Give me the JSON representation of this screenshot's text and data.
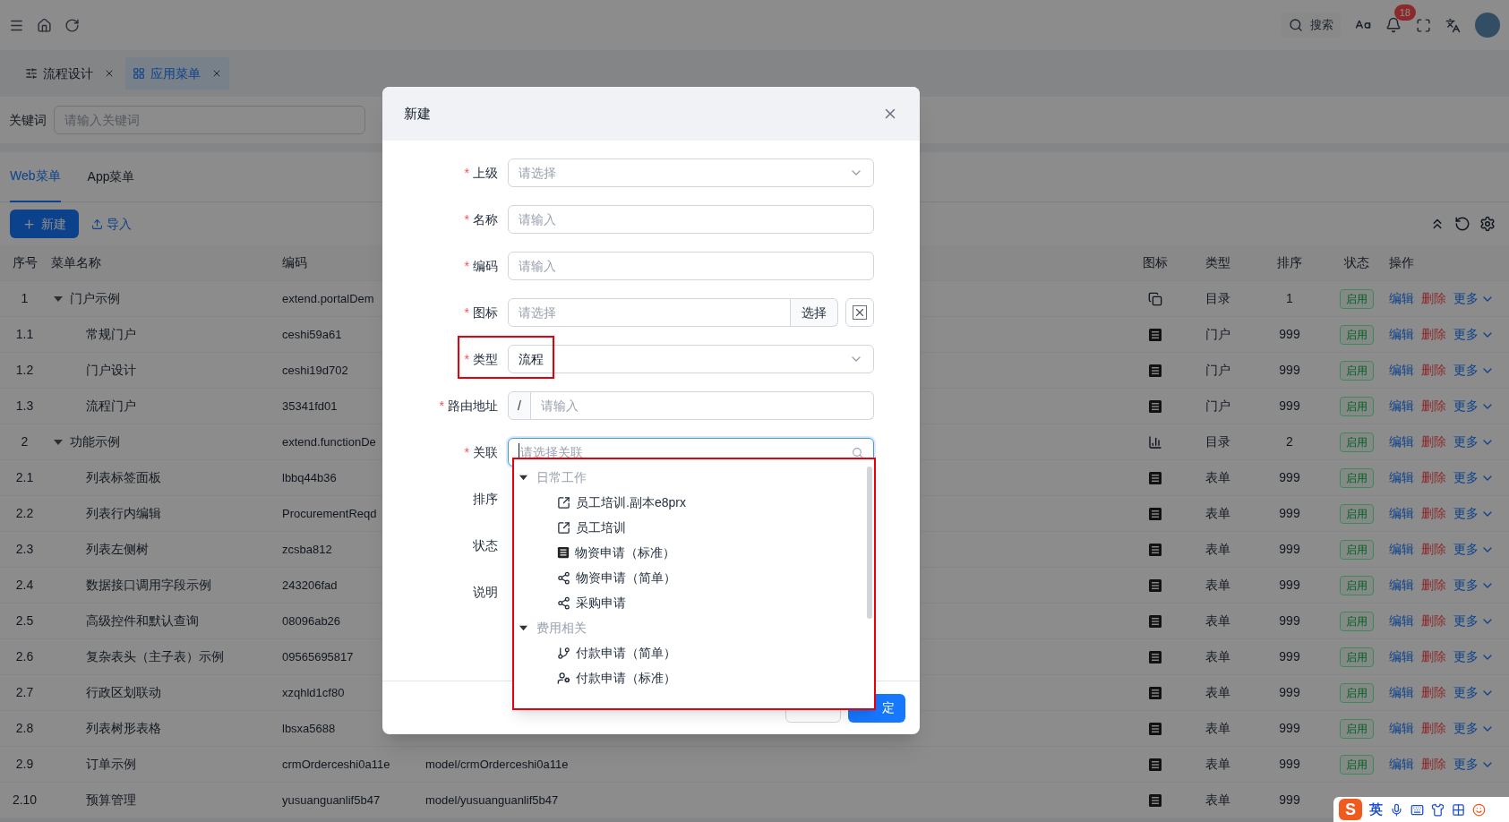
{
  "topbar": {
    "search_label": "搜索",
    "notification_count": "18"
  },
  "page_tabs": [
    {
      "label": "流程设计",
      "kind": "flow",
      "selected": false
    },
    {
      "label": "应用菜单",
      "kind": "grid",
      "selected": true
    }
  ],
  "filter": {
    "label": "关键词",
    "placeholder": "请输入关键词"
  },
  "menu_tabs": [
    {
      "label": "Web菜单",
      "selected": true
    },
    {
      "label": "App菜单",
      "selected": false
    }
  ],
  "toolbar": {
    "new_button": "新建",
    "import_button": "导入"
  },
  "table": {
    "columns": [
      "序号",
      "菜单名称",
      "编码",
      "图标",
      "类型",
      "排序",
      "状态",
      "操作"
    ],
    "rows": [
      {
        "no": "1",
        "name": "门户示例",
        "code": "extend.portalDem",
        "kind": "window",
        "type": "目录",
        "sort": "1",
        "status": "启用",
        "actions": [
          {
            "label": "编辑",
            "kind": "edit"
          },
          {
            "label": "删除",
            "kind": "delete"
          },
          {
            "label": "更多",
            "kind": "more"
          }
        ],
        "expanded": true,
        "children": [
          {
            "no": "1.1",
            "name": "常规门户",
            "code": "ceshi59a61",
            "kind": "list",
            "type": "门户",
            "sort": "999",
            "status": "启用",
            "actions": [
              {
                "label": "编辑",
                "kind": "edit"
              },
              {
                "label": "删除",
                "kind": "delete"
              },
              {
                "label": "更多",
                "kind": "more"
              }
            ]
          },
          {
            "no": "1.2",
            "name": "门户设计",
            "code": "ceshi19d702",
            "kind": "list",
            "type": "门户",
            "sort": "999",
            "status": "启用",
            "actions": [
              {
                "label": "编辑",
                "kind": "edit"
              },
              {
                "label": "删除",
                "kind": "delete"
              },
              {
                "label": "更多",
                "kind": "more"
              }
            ]
          },
          {
            "no": "1.3",
            "name": "流程门户",
            "code": "35341fd01",
            "kind": "list",
            "type": "门户",
            "sort": "999",
            "status": "启用",
            "actions": [
              {
                "label": "编辑",
                "kind": "edit"
              },
              {
                "label": "删除",
                "kind": "delete"
              },
              {
                "label": "更多",
                "kind": "more"
              }
            ]
          }
        ]
      },
      {
        "no": "2",
        "name": "功能示例",
        "code": "extend.functionDe",
        "kind": "chart",
        "type": "目录",
        "sort": "2",
        "status": "启用",
        "actions": [
          {
            "label": "编辑",
            "kind": "edit"
          },
          {
            "label": "删除",
            "kind": "delete"
          },
          {
            "label": "更多",
            "kind": "more"
          }
        ],
        "expanded": true,
        "children": [
          {
            "no": "2.1",
            "name": "列表标签面板",
            "code": "lbbq44b36",
            "kind": "list",
            "type": "表单",
            "sort": "999",
            "status": "启用",
            "actions": [
              {
                "label": "编辑",
                "kind": "edit"
              },
              {
                "label": "删除",
                "kind": "delete"
              },
              {
                "label": "更多",
                "kind": "more"
              }
            ]
          },
          {
            "no": "2.2",
            "name": "列表行内编辑",
            "code": "ProcurementReqd",
            "kind": "list",
            "type": "表单",
            "sort": "999",
            "status": "启用",
            "actions": [
              {
                "label": "编辑",
                "kind": "edit"
              },
              {
                "label": "删除",
                "kind": "delete"
              },
              {
                "label": "更多",
                "kind": "more"
              }
            ]
          },
          {
            "no": "2.3",
            "name": "列表左侧树",
            "code": "zcsba812",
            "kind": "list",
            "type": "表单",
            "sort": "999",
            "status": "启用",
            "actions": [
              {
                "label": "编辑",
                "kind": "edit"
              },
              {
                "label": "删除",
                "kind": "delete"
              },
              {
                "label": "更多",
                "kind": "more"
              }
            ]
          },
          {
            "no": "2.4",
            "name": "数据接口调用字段示例",
            "code": "243206fad",
            "kind": "list",
            "type": "表单",
            "sort": "999",
            "status": "启用",
            "actions": [
              {
                "label": "编辑",
                "kind": "edit"
              },
              {
                "label": "删除",
                "kind": "delete"
              },
              {
                "label": "更多",
                "kind": "more"
              }
            ]
          },
          {
            "no": "2.5",
            "name": "高级控件和默认查询",
            "code": "08096ab26",
            "kind": "list",
            "type": "表单",
            "sort": "999",
            "status": "启用",
            "actions": [
              {
                "label": "编辑",
                "kind": "edit"
              },
              {
                "label": "删除",
                "kind": "delete"
              },
              {
                "label": "更多",
                "kind": "more"
              }
            ]
          },
          {
            "no": "2.6",
            "name": "复杂表头（主子表）示例",
            "code": "09565695817",
            "kind": "list",
            "type": "表单",
            "sort": "999",
            "status": "启用",
            "actions": [
              {
                "label": "编辑",
                "kind": "edit"
              },
              {
                "label": "删除",
                "kind": "delete"
              },
              {
                "label": "更多",
                "kind": "more"
              }
            ]
          },
          {
            "no": "2.7",
            "name": "行政区划联动",
            "code": "xzqhld1cf80",
            "kind": "list",
            "type": "表单",
            "sort": "999",
            "status": "启用",
            "actions": [
              {
                "label": "编辑",
                "kind": "edit"
              },
              {
                "label": "删除",
                "kind": "delete"
              },
              {
                "label": "更多",
                "kind": "more"
              }
            ]
          },
          {
            "no": "2.8",
            "name": "列表树形表格",
            "code": "lbsxa5688",
            "kind": "list",
            "type": "表单",
            "sort": "999",
            "status": "启用",
            "actions": [
              {
                "label": "编辑",
                "kind": "edit"
              },
              {
                "label": "删除",
                "kind": "delete"
              },
              {
                "label": "更多",
                "kind": "more"
              }
            ]
          },
          {
            "no": "2.9",
            "name": "订单示例",
            "code": "crmOrderceshi0a11e",
            "path": "model/crmOrderceshi0a11e",
            "kind": "list",
            "type": "表单",
            "sort": "999",
            "status": "启用",
            "actions": [
              {
                "label": "编辑",
                "kind": "edit"
              },
              {
                "label": "删除",
                "kind": "delete"
              },
              {
                "label": "更多",
                "kind": "more"
              }
            ]
          },
          {
            "no": "2.10",
            "name": "预算管理",
            "code": "yusuanguanlif5b47",
            "path": "model/yusuanguanlif5b47",
            "kind": "list",
            "type": "表单",
            "sort": "999"
          }
        ]
      }
    ]
  },
  "dialog": {
    "title": "新建",
    "fields": [
      {
        "label": "上级",
        "required_mark": "*",
        "kind": "select",
        "placeholder": "请选择"
      },
      {
        "label": "名称",
        "required_mark": "*",
        "kind": "input",
        "placeholder": "请输入"
      },
      {
        "label": "编码",
        "required_mark": "*",
        "kind": "input",
        "placeholder": "请输入"
      },
      {
        "label": "图标",
        "required_mark": "*",
        "kind": "icon-picker",
        "placeholder": "请选择",
        "button": "选择"
      },
      {
        "label": "类型",
        "required_mark": "*",
        "kind": "select",
        "value": "流程",
        "highlighted": true
      },
      {
        "label": "路由地址",
        "required_mark": "*",
        "kind": "prefixed",
        "prefix": "/",
        "placeholder": "请输入"
      },
      {
        "label": "关联",
        "required_mark": "*",
        "kind": "search",
        "placeholder": "请选择关联",
        "focused": true
      },
      {
        "label": "排序",
        "kind": "covered"
      },
      {
        "label": "状态",
        "kind": "covered"
      },
      {
        "label": "说明",
        "kind": "covered"
      }
    ],
    "dropdown": {
      "highlighted": true,
      "groups": [
        {
          "label": "日常工作",
          "expanded": true,
          "disabled": true,
          "children": [
            {
              "label": "员工培训.副本e8prx",
              "kind": "external"
            },
            {
              "label": "员工培训",
              "kind": "external"
            },
            {
              "label": "物资申请（标准）",
              "kind": "list"
            },
            {
              "label": "物资申请（简单）",
              "kind": "share"
            },
            {
              "label": "采购申请",
              "kind": "share"
            }
          ]
        },
        {
          "label": "费用相关",
          "expanded": true,
          "disabled": true,
          "children": [
            {
              "label": "付款申请（简单）",
              "kind": "branch"
            },
            {
              "label": "付款申请（标准）",
              "kind": "user-gear"
            }
          ]
        }
      ]
    },
    "confirm_button": "定"
  },
  "ime_toolbar": {
    "logo": "S",
    "mode": "英"
  }
}
